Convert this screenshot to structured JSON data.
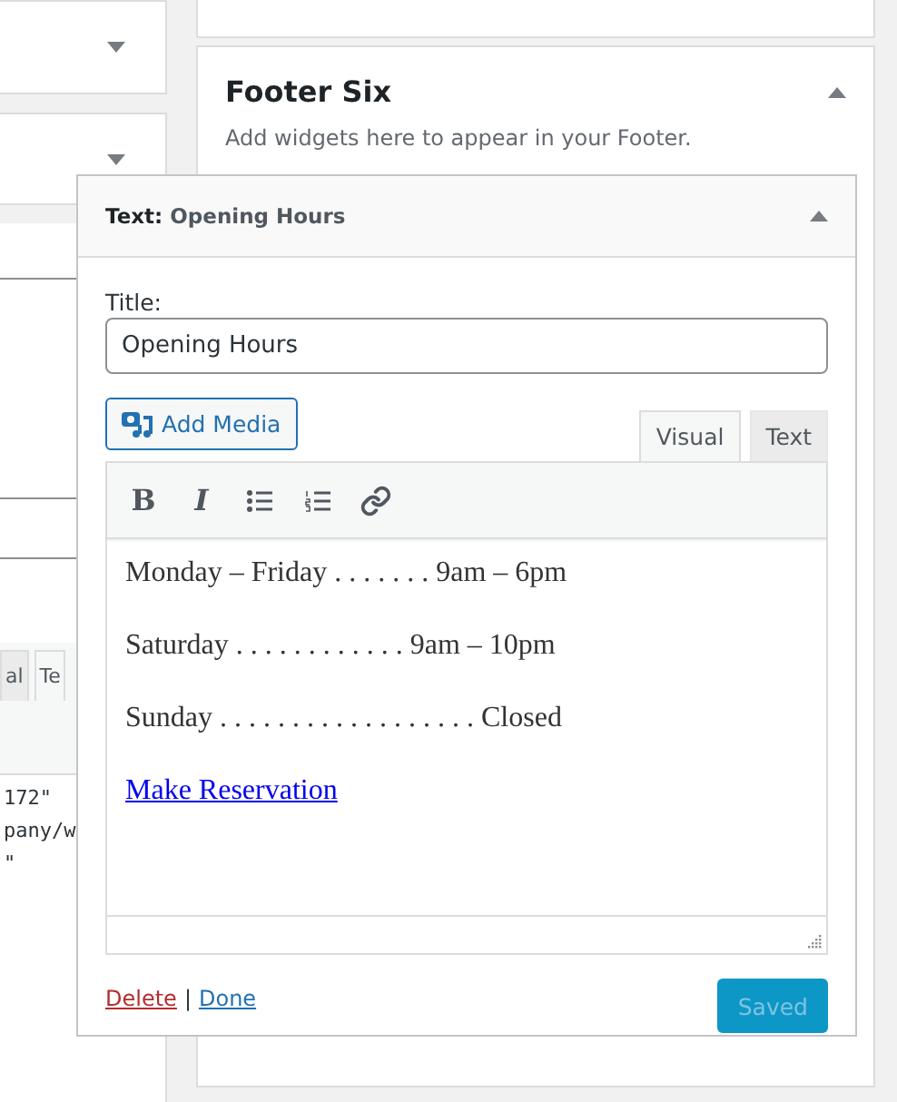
{
  "left_column": {
    "tabs": [
      {
        "label": "al",
        "selected": false
      },
      {
        "label": "Te",
        "selected": true
      }
    ],
    "code_lines": [
      "172\"",
      "pany/w",
      "\""
    ]
  },
  "sidebar": {
    "title": "Footer Six",
    "description": "Add widgets here to appear in your Footer."
  },
  "widget": {
    "type_label": "Text:",
    "name": "Opening Hours",
    "expanded": true,
    "title_label": "Title:",
    "title_value": "Opening Hours",
    "add_media": "Add Media",
    "editor_tabs": [
      {
        "label": "Visual",
        "selected": true
      },
      {
        "label": "Text",
        "selected": false
      }
    ],
    "toolbar": [
      {
        "kind": "bold",
        "label": "B"
      },
      {
        "kind": "italic",
        "label": "I"
      },
      {
        "kind": "bullets"
      },
      {
        "kind": "numbers"
      },
      {
        "kind": "link"
      }
    ],
    "content": [
      {
        "kind": "text",
        "text": "Monday – Friday . . . . . . . 9am – 6pm"
      },
      {
        "kind": "text",
        "text": "Saturday . . . . . . . . . . . . 9am – 10pm"
      },
      {
        "kind": "text",
        "text": "Sunday . . . . . . . . . . . . . . . . . . Closed"
      },
      {
        "kind": "link",
        "text": "Make Reservation"
      }
    ],
    "delete": "Delete",
    "separator": "|",
    "done": "Done",
    "save": {
      "label": "Saved",
      "disabled": true
    }
  }
}
